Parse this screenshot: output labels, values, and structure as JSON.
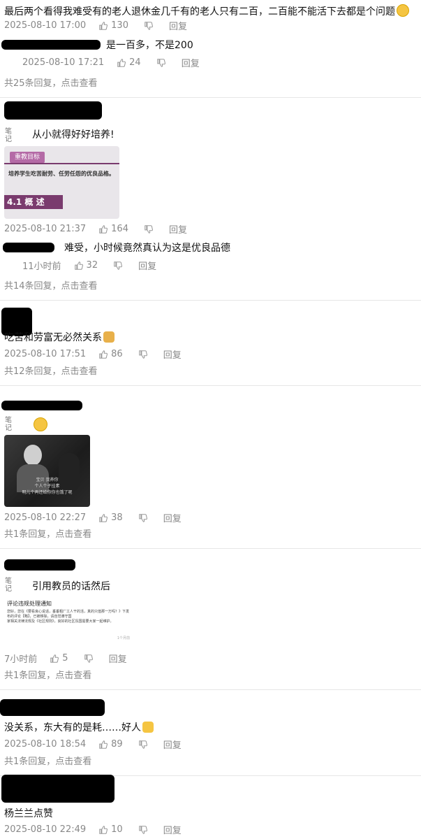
{
  "comments": [
    {
      "text": "最后两个看得我难受有的老人退休金几千有的老人只有二百，二百能不能活下去都是个问题",
      "date": "2025-08-10 17:00",
      "likes": "130",
      "reply_label": "回复",
      "sub": {
        "text": "是一百多，不是200",
        "date": "2025-08-10 17:21",
        "likes": "24",
        "reply_label": "回复"
      },
      "more": "共25条回复，点击查看"
    },
    {
      "badge": "笔记",
      "text": "从小就得好好培养!",
      "image": {
        "header": "重教目标",
        "line": "培养学生吃苦耐劳、任劳任怨的优良品格。",
        "section": "4.1  概  述"
      },
      "date": "2025-08-10 21:37",
      "likes": "164",
      "reply_label": "回复",
      "sub": {
        "text": "难受，小时候竟然真认为这是优良品德",
        "date": "11小时前",
        "likes": "32",
        "reply_label": "回复"
      },
      "more": "共14条回复，点击查看"
    },
    {
      "text": "吃苦和劳富无必然关系",
      "date": "2025-08-10 17:51",
      "likes": "86",
      "reply_label": "回复",
      "more": "共12条回复，点击查看"
    },
    {
      "badge": "笔记",
      "image": {
        "subtitle1": "宝贝  我养你",
        "subtitle2": "个人个子挂素",
        "subtitle3": "明儿个再还给你你也饿了呢"
      },
      "date": "2025-08-10 22:27",
      "likes": "38",
      "reply_label": "回复",
      "more": "共1条回复，点击查看"
    },
    {
      "badge": "笔记",
      "text": "引用教员的话然后",
      "image": {
        "title": "评论违规处理通知",
        "body1": "您好，您在《要看良心说话，垂垂粗厂工人干的活，真的只值那一万吗？》下发布的评论【略】，已被移除。请自觉遵守国",
        "body2": "家相关法律法规及《社区规则》，良好的社区氛围需要大家一起维护。",
        "footer": "1个月前"
      },
      "date": "7小时前",
      "likes": "5",
      "reply_label": "回复",
      "more": "共1条回复，点击查看"
    },
    {
      "text": "没关系，东大有的是耗……好人",
      "date": "2025-08-10 18:54",
      "likes": "89",
      "reply_label": "回复",
      "more": "共1条回复，点击查看"
    },
    {
      "text": "杨兰兰点赞",
      "date": "2025-08-10 22:49",
      "likes": "10",
      "reply_label": "回复"
    }
  ],
  "colors": {
    "meta": "#888888",
    "divider": "#e6e6e6",
    "emoji_yellow": "#f5c542"
  },
  "icons": [
    "thumb-up-icon",
    "thumb-down-icon",
    "sad-face-emoji",
    "dog-face-emoji",
    "shocked-face-emoji",
    "thumbs-up-emoji",
    "note-badge-icon"
  ]
}
